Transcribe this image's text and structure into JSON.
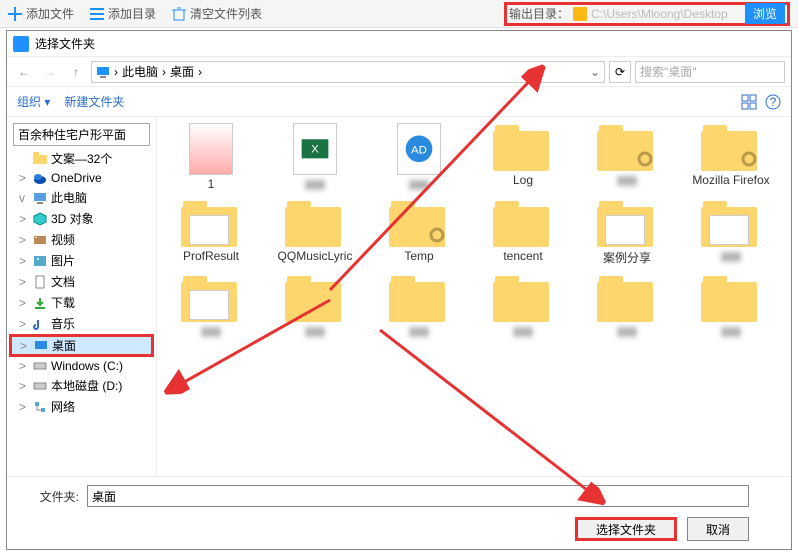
{
  "top_toolbar": {
    "add_file": "添加文件",
    "add_dir": "添加目录",
    "clear_list": "清空文件列表",
    "output_label": "输出目录：",
    "output_path": "C:\\Users\\Mloong\\Desktop",
    "browse": "浏览"
  },
  "dialog": {
    "title": "选择文件夹",
    "breadcrumb": {
      "pc": "此电脑",
      "desktop": "桌面",
      "sep": "›"
    },
    "search_placeholder": "搜索\"桌面\"",
    "organize": "组织 ▾",
    "new_folder": "新建文件夹"
  },
  "sidebar": {
    "tooltip": "百余种住宅户形平面",
    "items": [
      {
        "label": "文案—32个",
        "icon": "folder"
      },
      {
        "label": "OneDrive",
        "icon": "onedrive",
        "exp": ">"
      },
      {
        "label": "此电脑",
        "icon": "pc",
        "exp": "v"
      },
      {
        "label": "3D 对象",
        "icon": "3d",
        "exp": ">"
      },
      {
        "label": "视频",
        "icon": "video",
        "exp": ">"
      },
      {
        "label": "图片",
        "icon": "pictures",
        "exp": ">"
      },
      {
        "label": "文档",
        "icon": "docs",
        "exp": ">"
      },
      {
        "label": "下载",
        "icon": "downloads",
        "exp": ">"
      },
      {
        "label": "音乐",
        "icon": "music",
        "exp": ">"
      },
      {
        "label": "桌面",
        "icon": "desktop",
        "exp": ">",
        "selected": true
      },
      {
        "label": "Windows (C:)",
        "icon": "disk",
        "exp": ">"
      },
      {
        "label": "本地磁盘 (D:)",
        "icon": "disk",
        "exp": ">"
      },
      {
        "label": "网络",
        "icon": "network",
        "exp": ">"
      }
    ]
  },
  "items": [
    {
      "label": "1",
      "type": "image"
    },
    {
      "label": "",
      "type": "xlsx",
      "blurred": true
    },
    {
      "label": "",
      "type": "file-ad",
      "blurred": true
    },
    {
      "label": "Log",
      "type": "folder"
    },
    {
      "label": "",
      "type": "folder-gear",
      "blurred": true
    },
    {
      "label": "Mozilla Firefox",
      "type": "folder-gear"
    },
    {
      "label": "ProfResult",
      "type": "folder-img"
    },
    {
      "label": "QQMusicLyric",
      "type": "folder"
    },
    {
      "label": "Temp",
      "type": "folder-gear"
    },
    {
      "label": "tencent",
      "type": "folder"
    },
    {
      "label": "案例分享",
      "type": "folder-img"
    },
    {
      "label": "",
      "type": "folder-img",
      "blurred": true
    },
    {
      "label": "",
      "type": "folder-img",
      "blurred": true
    },
    {
      "label": "",
      "type": "folder",
      "blurred": true
    },
    {
      "label": "",
      "type": "folder",
      "blurred": true
    },
    {
      "label": "",
      "type": "folder",
      "blurred": true
    },
    {
      "label": "",
      "type": "folder",
      "blurred": true
    },
    {
      "label": "",
      "type": "folder",
      "blurred": true
    }
  ],
  "footer": {
    "folder_label": "文件夹:",
    "folder_value": "桌面",
    "select_btn": "选择文件夹",
    "cancel_btn": "取消"
  }
}
